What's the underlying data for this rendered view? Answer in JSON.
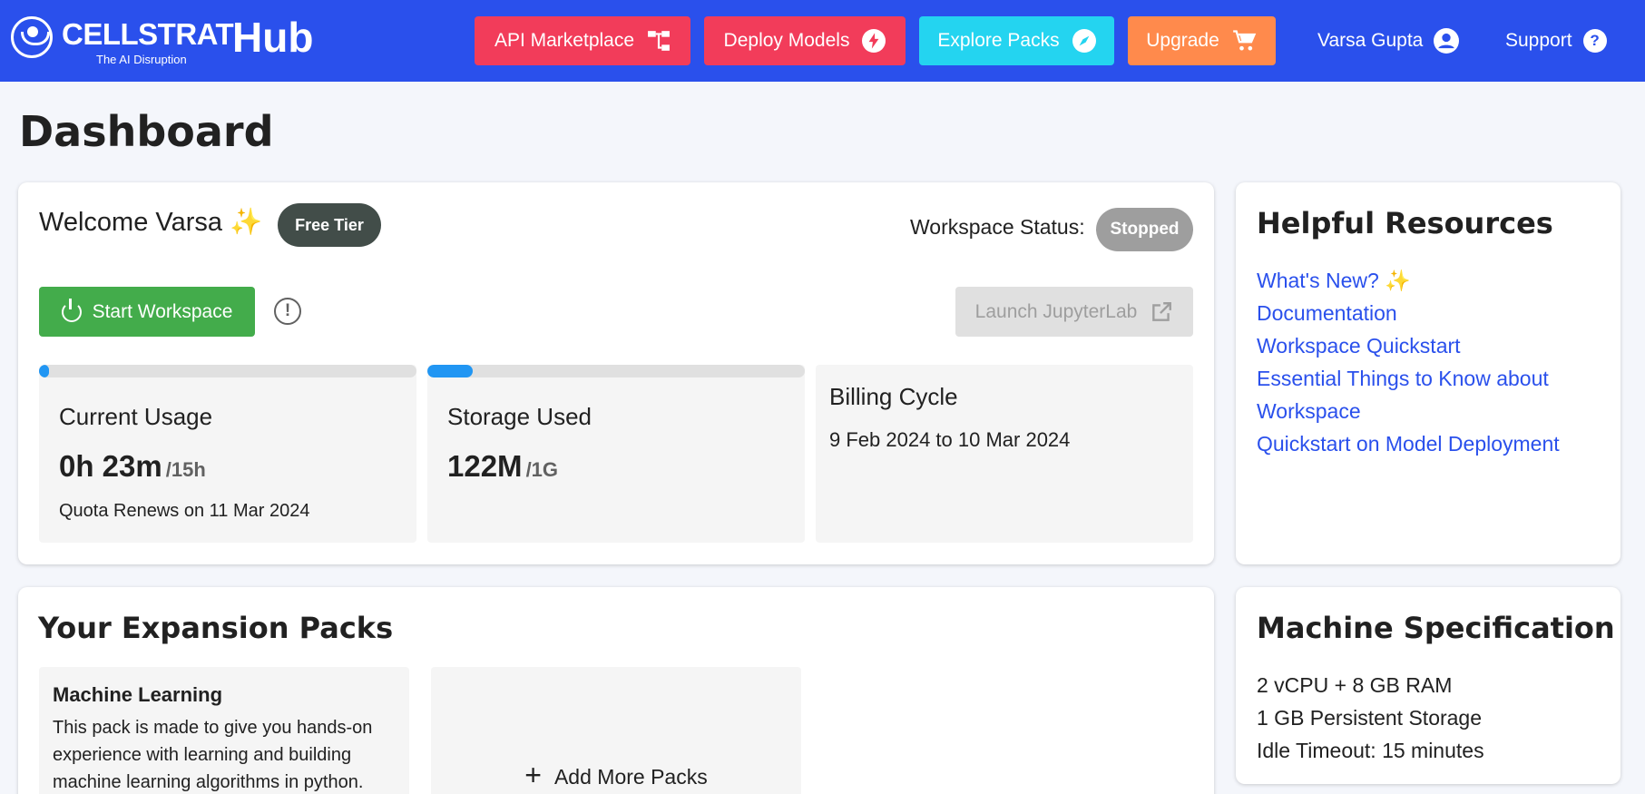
{
  "header": {
    "brand": "CELLSTRAT",
    "tagline": "The AI Disruption",
    "hub": "Hub",
    "nav": {
      "api": "API Marketplace",
      "deploy": "Deploy Models",
      "explore": "Explore Packs",
      "upgrade": "Upgrade",
      "user": "Varsa Gupta",
      "support": "Support"
    },
    "icons": {
      "api": "hierarchy-icon",
      "deploy": "bolt-icon",
      "explore": "compass-icon",
      "upgrade": "cart-icon",
      "user": "account-circle-icon",
      "support": "help-circle-icon"
    },
    "colors": {
      "bar": "#2a50ec",
      "api": "#f23c5a",
      "deploy": "#f23c5a",
      "explore": "#24d4f0",
      "upgrade": "#ff8a4c"
    }
  },
  "page": {
    "title": "Dashboard"
  },
  "welcome": {
    "greeting": "Welcome Varsa ✨",
    "tier": "Free Tier",
    "status_label": "Workspace Status:",
    "status": "Stopped",
    "start_label": "Start Workspace",
    "launch_label": "Launch JupyterLab"
  },
  "usage": {
    "title": "Current Usage",
    "value": "0h 23m",
    "limit": "/15h",
    "note": "Quota Renews on 11 Mar 2024",
    "fraction": 0.026
  },
  "storage": {
    "title": "Storage Used",
    "value": "122M",
    "limit": "/1G",
    "fraction": 0.119
  },
  "billing": {
    "title": "Billing Cycle",
    "dates": "9 Feb 2024 to 10 Mar 2024"
  },
  "resources": {
    "title": "Helpful Resources",
    "links": [
      "What's New? ✨",
      "Documentation",
      "Workspace Quickstart",
      "Essential Things to Know about Workspace",
      "Quickstart on Model Deployment"
    ]
  },
  "packs": {
    "title": "Your Expansion Packs",
    "items": [
      {
        "title": "Machine Learning",
        "description": "This pack is made to give you hands-on experience with learning and building machine learning algorithms in python."
      }
    ],
    "add_label": "Add More Packs"
  },
  "spec": {
    "title": "Machine Specification",
    "items": [
      "2 vCPU + 8 GB RAM",
      "1 GB Persistent Storage",
      "Idle Timeout: 15 minutes"
    ]
  }
}
